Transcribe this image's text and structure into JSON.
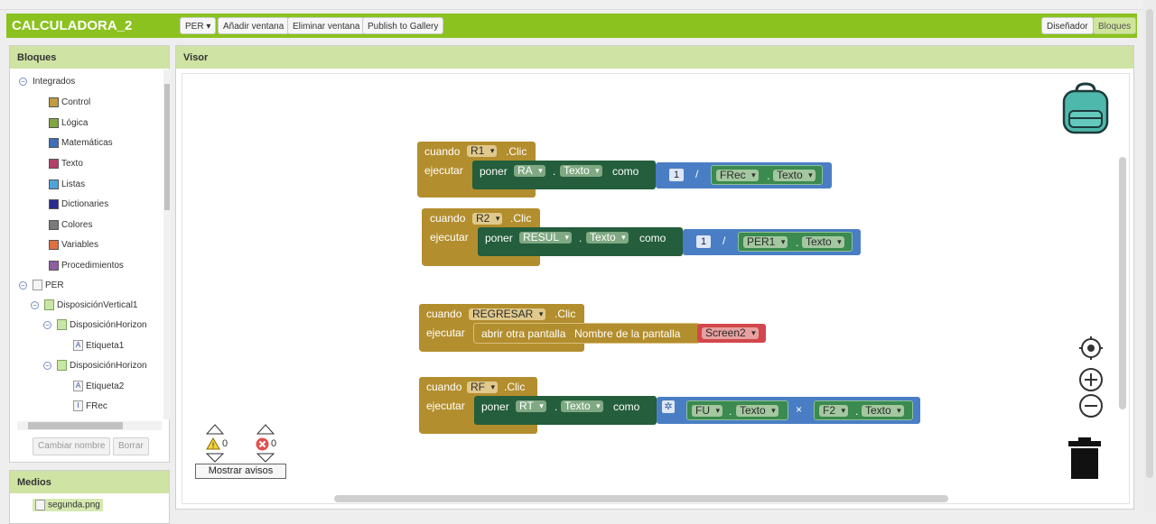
{
  "app": {
    "title": "CALCULADORA_2"
  },
  "toolbar": {
    "screen_select": "PER ▾",
    "add_window": "Añadir ventana",
    "remove_window": "Eliminar ventana",
    "publish": "Publish to Gallery",
    "designer": "Diseñador",
    "blocks": "Bloques"
  },
  "blocks_panel": {
    "title": "Bloques",
    "builtin_label": "Integrados",
    "builtin": [
      {
        "label": "Control",
        "color": "#c39b3f"
      },
      {
        "label": "Lógica",
        "color": "#7fa83f"
      },
      {
        "label": "Matemáticas",
        "color": "#3f6fb5"
      },
      {
        "label": "Texto",
        "color": "#b33f6b"
      },
      {
        "label": "Listas",
        "color": "#4fa3d8"
      },
      {
        "label": "Dictionaries",
        "color": "#2a2a8f"
      },
      {
        "label": "Colores",
        "color": "#7a7a7a"
      },
      {
        "label": "Variables",
        "color": "#e06f3f"
      },
      {
        "label": "Procedimientos",
        "color": "#8f5f9f"
      }
    ],
    "components": [
      {
        "label": "PER"
      },
      {
        "label": "DisposiciónVertical1"
      },
      {
        "label": "DisposiciónHorizon"
      },
      {
        "label": "Etiqueta1"
      },
      {
        "label": "DisposiciónHorizon"
      },
      {
        "label": "Etiqueta2"
      },
      {
        "label": "FRec"
      }
    ],
    "rename_button": "Cambiar nombre",
    "delete_button": "Borrar"
  },
  "media_panel": {
    "title": "Medios",
    "file": "segunda.png"
  },
  "viewer": {
    "title": "Visor"
  },
  "blocks": {
    "b1": {
      "when": "cuando",
      "component": "R1",
      "event": ".Clic",
      "do": "ejecutar",
      "set": "poner",
      "target": "RA",
      "dot": ".",
      "prop": "Texto",
      "to": "como",
      "num": "1",
      "op": "/",
      "arg": "FRec",
      "arg_prop": "Texto"
    },
    "b2": {
      "when": "cuando",
      "component": "R2",
      "event": ".Clic",
      "do": "ejecutar",
      "set": "poner",
      "target": "RESUL",
      "dot": ".",
      "prop": "Texto",
      "to": "como",
      "num": "1",
      "op": "/",
      "arg": "PER1",
      "arg_prop": "Texto"
    },
    "b3": {
      "when": "cuando",
      "component": "REGRESAR",
      "event": ".Clic",
      "do": "ejecutar",
      "open": "abrir otra pantalla",
      "screen_name": "Nombre de la pantalla",
      "screen": "Screen2"
    },
    "b4": {
      "when": "cuando",
      "component": "RF",
      "event": ".Clic",
      "do": "ejecutar",
      "set": "poner",
      "target": "RT",
      "dot": ".",
      "prop": "Texto",
      "to": "como",
      "arg1": "FU",
      "arg1_prop": "Texto",
      "op": "×",
      "arg2": "F2",
      "arg2_prop": "Texto"
    }
  },
  "warnings": {
    "warn_count": "0",
    "error_count": "0",
    "show_button": "Mostrar avisos"
  }
}
